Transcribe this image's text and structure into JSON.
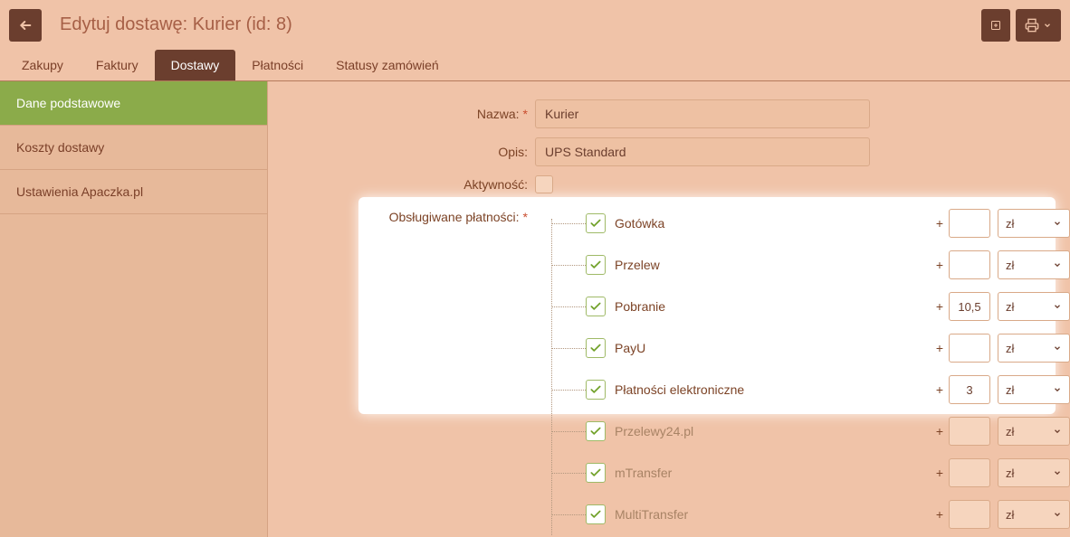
{
  "header": {
    "title": "Edytuj dostawę: Kurier (id: 8)"
  },
  "tabs": [
    {
      "label": "Zakupy",
      "active": false
    },
    {
      "label": "Faktury",
      "active": false
    },
    {
      "label": "Dostawy",
      "active": true
    },
    {
      "label": "Płatności",
      "active": false
    },
    {
      "label": "Statusy zamówień",
      "active": false
    }
  ],
  "sidebar": [
    {
      "label": "Dane podstawowe",
      "active": true
    },
    {
      "label": "Koszty dostawy",
      "active": false
    },
    {
      "label": "Ustawienia Apaczka.pl",
      "active": false
    }
  ],
  "form": {
    "name_label": "Nazwa:",
    "name_value": "Kurier",
    "desc_label": "Opis:",
    "desc_value": "UPS Standard",
    "active_label": "Aktywność:",
    "active_checked": false,
    "payments_label": "Obsługiwane płatności:",
    "currency_default": "zł",
    "payments": [
      {
        "name": "Gotówka",
        "checked": true,
        "amount": "",
        "highlighted": true
      },
      {
        "name": "Przelew",
        "checked": true,
        "amount": "",
        "highlighted": true
      },
      {
        "name": "Pobranie",
        "checked": true,
        "amount": "10,5",
        "highlighted": true
      },
      {
        "name": "PayU",
        "checked": true,
        "amount": "",
        "highlighted": true
      },
      {
        "name": "Płatności elektroniczne",
        "checked": true,
        "amount": "3",
        "highlighted": true
      },
      {
        "name": "Przelewy24.pl",
        "checked": true,
        "amount": "",
        "highlighted": false
      },
      {
        "name": "mTransfer",
        "checked": true,
        "amount": "",
        "highlighted": false
      },
      {
        "name": "MultiTransfer",
        "checked": true,
        "amount": "",
        "highlighted": false
      }
    ]
  }
}
